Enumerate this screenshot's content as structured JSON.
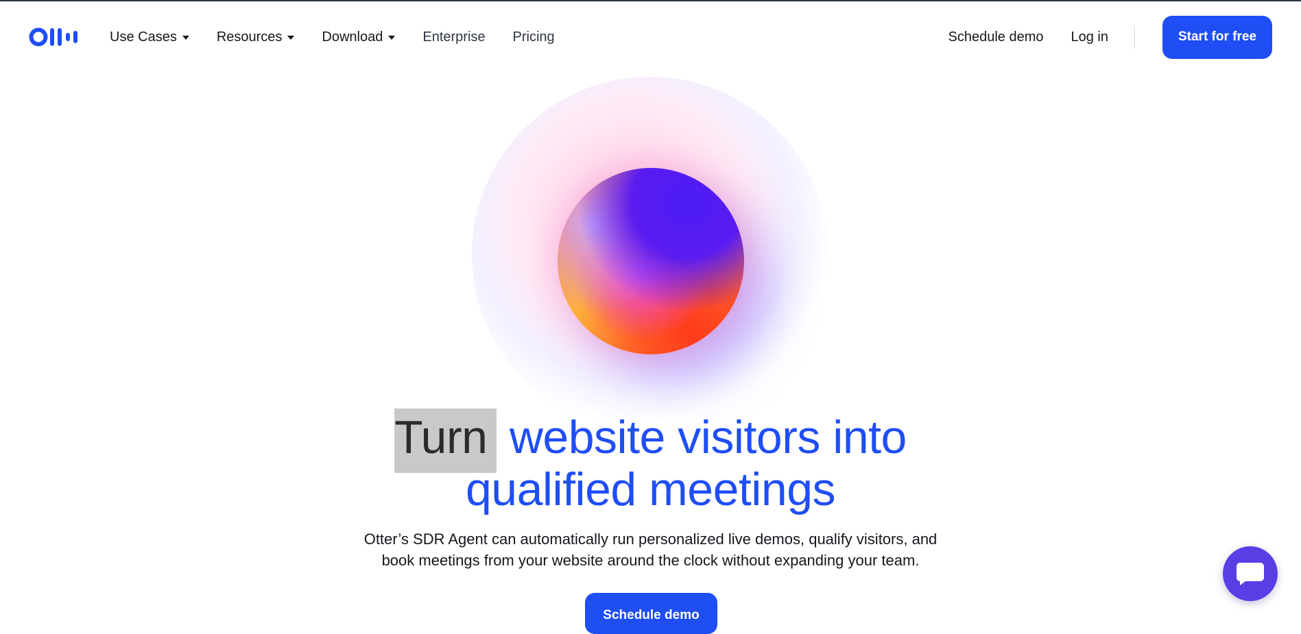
{
  "brand": {
    "name": "Otter",
    "accent_color": "#1f4ef5"
  },
  "nav": {
    "items": [
      {
        "label": "Use Cases",
        "has_dropdown": true
      },
      {
        "label": "Resources",
        "has_dropdown": true
      },
      {
        "label": "Download",
        "has_dropdown": true
      },
      {
        "label": "Enterprise",
        "has_dropdown": false
      },
      {
        "label": "Pricing",
        "has_dropdown": false
      }
    ],
    "schedule_demo": "Schedule demo",
    "login": "Log in",
    "cta": "Start for free"
  },
  "hero": {
    "headline_highlight": "Turn",
    "headline_rest": "website visitors into",
    "headline_line2": "qualified meetings",
    "subtext_line1": "Otter’s SDR Agent can automatically run personalized live demos, qualify visitors, and",
    "subtext_line2": "book meetings from your website around the clock without expanding your team.",
    "button": "Schedule demo"
  },
  "chat_widget": {
    "icon": "chat-bubble-icon"
  }
}
